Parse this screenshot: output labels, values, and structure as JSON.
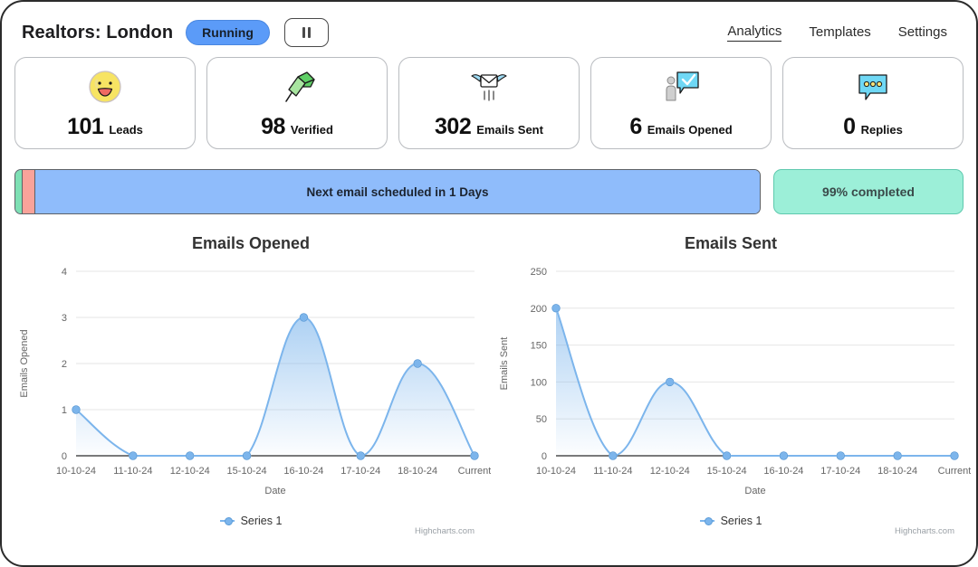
{
  "header": {
    "title": "Realtors: London",
    "status": "Running",
    "pause_icon": "pause-icon",
    "nav": [
      {
        "label": "Analytics",
        "active": true
      },
      {
        "label": "Templates",
        "active": false
      },
      {
        "label": "Settings",
        "active": false
      }
    ]
  },
  "stats": [
    {
      "value": "101",
      "label": "Leads",
      "icon": "smiley-face-icon"
    },
    {
      "value": "98",
      "label": "Verified",
      "icon": "green-flag-icon"
    },
    {
      "value": "302",
      "label": "Emails Sent",
      "icon": "flying-envelope-icon"
    },
    {
      "value": "6",
      "label": "Emails Opened",
      "icon": "person-checkmark-bubble-icon"
    },
    {
      "value": "0",
      "label": "Replies",
      "icon": "speech-bubble-dots-icon"
    }
  ],
  "progress": {
    "bar_text": "Next email scheduled in 1 Days",
    "completed_text": "99% completed",
    "bar_color": "#8fbcfb",
    "segment_green": "#7ee0b4",
    "segment_salmon": "#f9a39a",
    "badge_color": "#9cefd8"
  },
  "charts": {
    "legend_label": "Series 1",
    "credits": "Highcharts.com"
  },
  "chart_data": [
    {
      "type": "area",
      "title": "Emails Opened",
      "xlabel": "Date",
      "ylabel": "Emails Opened",
      "categories": [
        "10-10-24",
        "11-10-24",
        "12-10-24",
        "15-10-24",
        "16-10-24",
        "17-10-24",
        "18-10-24",
        "Current"
      ],
      "series": [
        {
          "name": "Series 1",
          "values": [
            1,
            0,
            0,
            0,
            3,
            0,
            2,
            0
          ]
        }
      ],
      "ylim": [
        0,
        4
      ],
      "yticks": [
        0,
        1,
        2,
        3,
        4
      ],
      "grid": true,
      "legend_position": "bottom",
      "line_color": "#7cb5ec"
    },
    {
      "type": "area",
      "title": "Emails Sent",
      "xlabel": "Date",
      "ylabel": "Emails Sent",
      "categories": [
        "10-10-24",
        "11-10-24",
        "12-10-24",
        "15-10-24",
        "16-10-24",
        "17-10-24",
        "18-10-24",
        "Current"
      ],
      "series": [
        {
          "name": "Series 1",
          "values": [
            200,
            0,
            100,
            0,
            0,
            0,
            0,
            0
          ]
        }
      ],
      "ylim": [
        0,
        250
      ],
      "yticks": [
        0,
        50,
        100,
        150,
        200,
        250
      ],
      "grid": true,
      "legend_position": "bottom",
      "line_color": "#7cb5ec"
    }
  ]
}
